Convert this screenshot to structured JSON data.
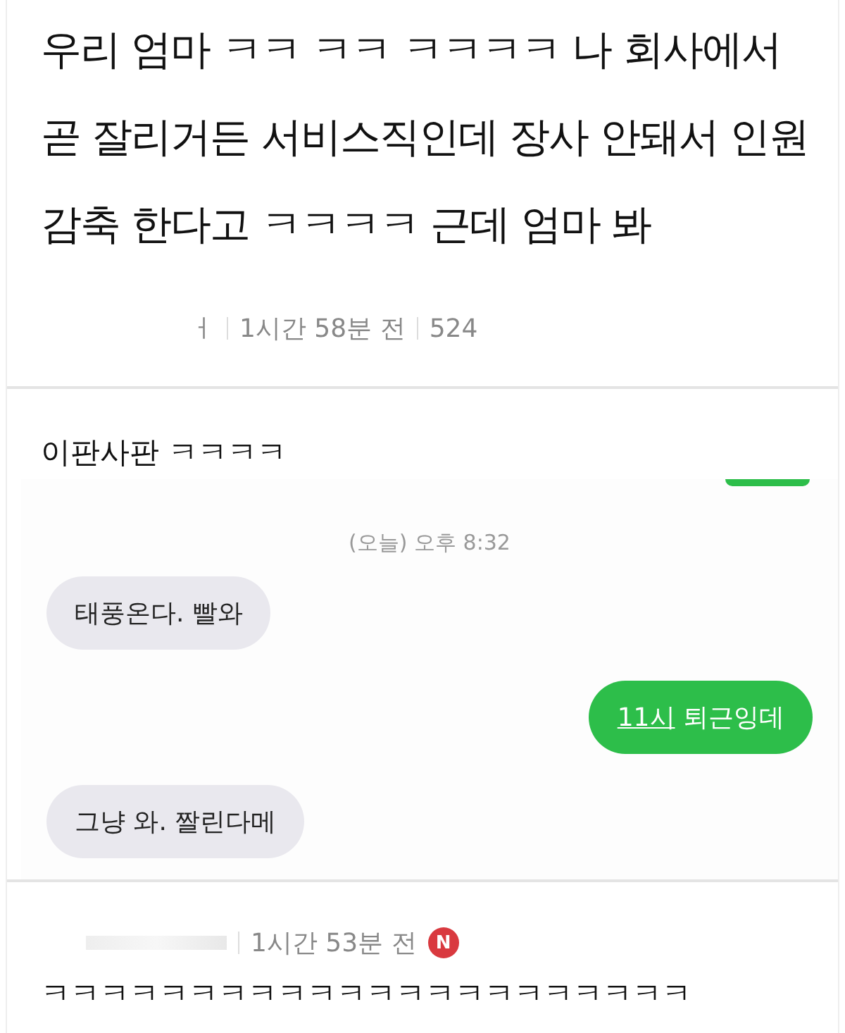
{
  "post": {
    "title": "우리 엄마 ㅋㅋ ㅋㅋ ㅋㅋㅋㅋ 나 회사에서 곧 잘리거든 서비스직인데 장사 안돼서 인원감축 한다고 ㅋㅋㅋㅋ 근데 엄마 봐",
    "author": "ㅓ",
    "time": "1시간 58분 전",
    "views": "524"
  },
  "comments": [
    {
      "text": "이판사판 ㅋㅋㅋㅋ",
      "chat": {
        "timestamp": "(오늘) 오후 8:32",
        "messages": [
          {
            "kind": "received",
            "text": "태풍온다. 빨와"
          },
          {
            "kind": "sent",
            "link": "11시",
            "text": "퇴근잉데"
          },
          {
            "kind": "received",
            "text": "그냥 와. 짤린다메"
          }
        ]
      }
    },
    {
      "time": "1시간 53분 전",
      "new_badge": "N",
      "text": "ㅋㅋㅋㅋㅋㅋㅋㅋㅋㅋㅋㅋㅋㅋㅋㅋㅋㅋㅋㅋㅋㅋ"
    }
  ]
}
